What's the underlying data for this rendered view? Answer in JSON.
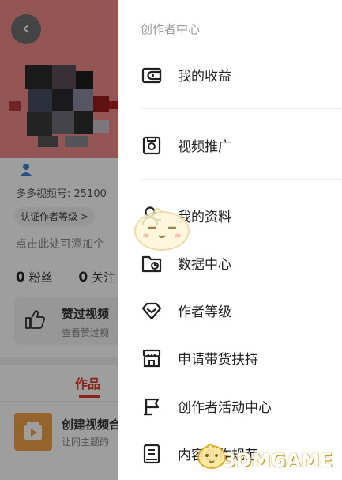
{
  "profile": {
    "back_icon": "chevron-left-icon",
    "video_id": "多多视频号: 25100",
    "cert_label": "认证作者等级 >",
    "bio": "点击此处可添加个",
    "stats": [
      {
        "value": "0",
        "label": "粉丝"
      },
      {
        "value": "0",
        "label": "关注"
      }
    ],
    "liked": {
      "title": "赞过视频",
      "subtitle": "查看赞过视"
    },
    "tab_works": "作品",
    "create": {
      "title": "创建视频合",
      "subtitle": "让同主题的"
    }
  },
  "drawer": {
    "title": "创作者中心",
    "items": [
      {
        "label": "我的收益",
        "icon": "wallet-icon"
      },
      {
        "label": "视频推广",
        "icon": "promo-icon"
      },
      {
        "label": "我的资料",
        "icon": "person-icon"
      },
      {
        "label": "数据中心",
        "icon": "data-folder-icon"
      },
      {
        "label": "作者等级",
        "icon": "level-heart-icon"
      },
      {
        "label": "申请带货扶持",
        "icon": "store-icon"
      },
      {
        "label": "创作者活动中心",
        "icon": "flag-icon"
      },
      {
        "label": "内容创作规范",
        "icon": "document-icon"
      }
    ]
  },
  "watermark": {
    "text": "3DMGAME"
  },
  "colors": {
    "accent": "#e23b2e",
    "hero": "#ef8a8a",
    "drawer_bg": "#ffffff"
  }
}
